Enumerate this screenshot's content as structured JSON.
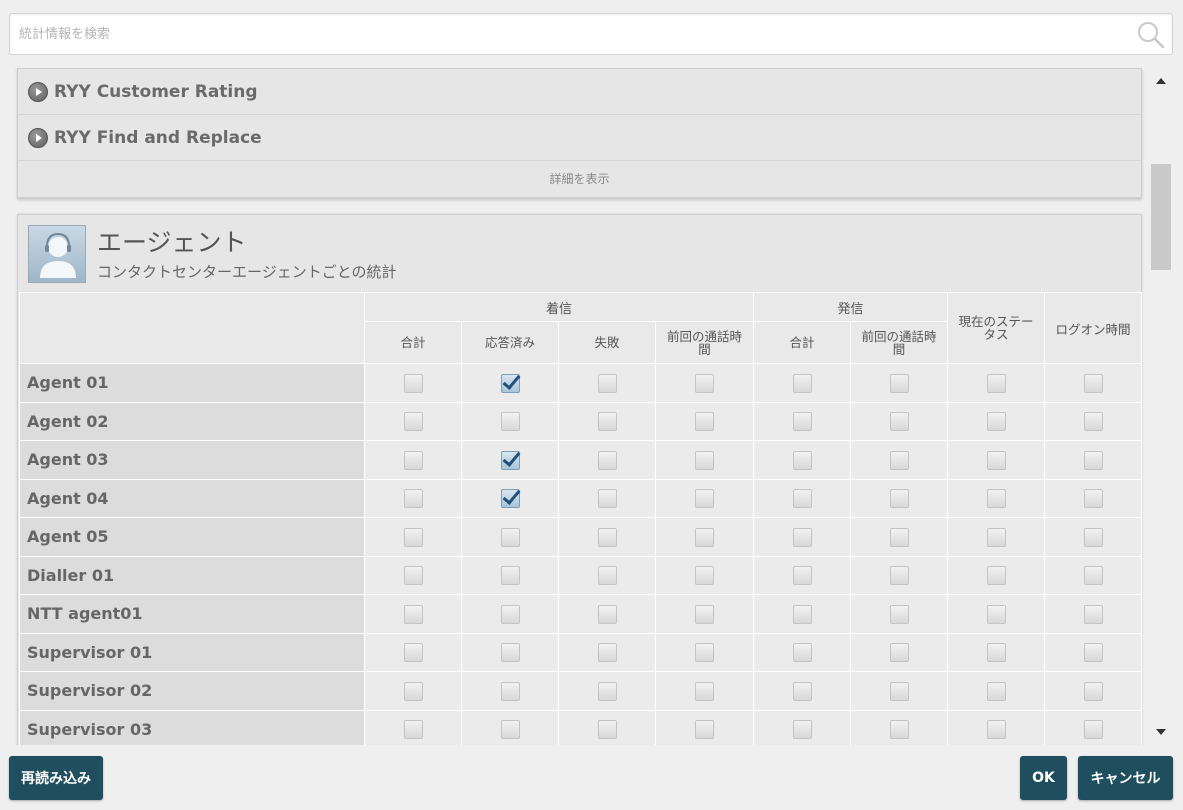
{
  "search": {
    "placeholder": "統計情報を検索",
    "value": ""
  },
  "reports": {
    "items": [
      {
        "label": "RYY Customer Rating"
      },
      {
        "label": "RYY Find and Replace"
      }
    ],
    "show_details": "詳細を表示"
  },
  "agent_section": {
    "title": "エージェント",
    "subtitle": "コンタクトセンターエージェントごとの統計",
    "groups": {
      "incoming": "着信",
      "outgoing": "発信"
    },
    "columns": {
      "in_total": "合計",
      "in_answered": "応答済み",
      "in_failed": "失敗",
      "in_last_call": "前回の通話時間",
      "out_total": "合計",
      "out_last_call": "前回の通話時間",
      "current_status": "現在のステータス",
      "logon_time": "ログオン時間"
    },
    "rows": [
      {
        "name": "Agent 01",
        "checks": [
          false,
          true,
          false,
          false,
          false,
          false,
          false,
          false
        ]
      },
      {
        "name": "Agent 02",
        "checks": [
          false,
          false,
          false,
          false,
          false,
          false,
          false,
          false
        ]
      },
      {
        "name": "Agent 03",
        "checks": [
          false,
          true,
          false,
          false,
          false,
          false,
          false,
          false
        ]
      },
      {
        "name": "Agent 04",
        "checks": [
          false,
          true,
          false,
          false,
          false,
          false,
          false,
          false
        ]
      },
      {
        "name": "Agent 05",
        "checks": [
          false,
          false,
          false,
          false,
          false,
          false,
          false,
          false
        ]
      },
      {
        "name": "Dialler 01",
        "checks": [
          false,
          false,
          false,
          false,
          false,
          false,
          false,
          false
        ]
      },
      {
        "name": "NTT agent01",
        "checks": [
          false,
          false,
          false,
          false,
          false,
          false,
          false,
          false
        ]
      },
      {
        "name": "Supervisor 01",
        "checks": [
          false,
          false,
          false,
          false,
          false,
          false,
          false,
          false
        ]
      },
      {
        "name": "Supervisor 02",
        "checks": [
          false,
          false,
          false,
          false,
          false,
          false,
          false,
          false
        ]
      },
      {
        "name": "Supervisor 03",
        "checks": [
          false,
          false,
          false,
          false,
          false,
          false,
          false,
          false
        ]
      }
    ]
  },
  "footer": {
    "reload": "再読み込み",
    "ok": "OK",
    "cancel": "キャンセル"
  },
  "colors": {
    "button_bg": "#1f4f5f",
    "checkbox_checked": "#1f4f7a",
    "panel_bg": "#e6e6e6"
  },
  "icons": {
    "search": "search-icon",
    "play": "play-icon",
    "agent": "agent-avatar-icon"
  }
}
